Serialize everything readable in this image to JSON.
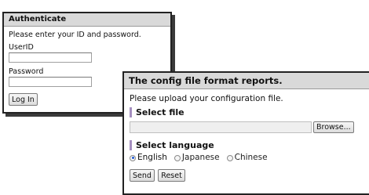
{
  "auth": {
    "title": "Authenticate",
    "instruction": "Please enter your ID and password.",
    "userid_label": "UserID",
    "userid_value": "",
    "password_label": "Password",
    "password_value": "",
    "login_button": "Log In"
  },
  "config": {
    "title": "The config file format reports.",
    "instruction": "Please upload your configuration file.",
    "select_file_title": "Select file",
    "file_path_value": "",
    "browse_button": "Browse...",
    "select_language_title": "Select language",
    "languages": [
      {
        "label": "English",
        "selected": true
      },
      {
        "label": "Japanese",
        "selected": false
      },
      {
        "label": "Chinese",
        "selected": false
      }
    ],
    "send_button": "Send",
    "reset_button": "Reset"
  },
  "colors": {
    "header_bg": "#d9d9d9",
    "section_accent": "#a58fc0",
    "radio_selected": "#1f5bd6"
  }
}
